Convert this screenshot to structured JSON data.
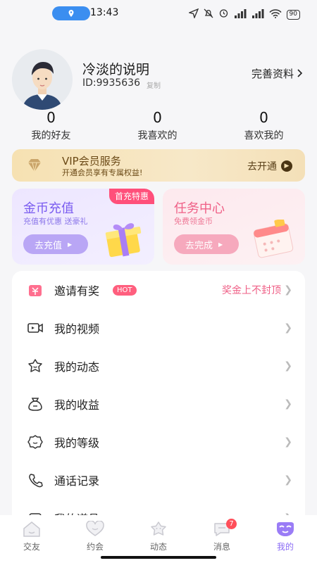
{
  "status_bar": {
    "time": "13:43",
    "battery": "90"
  },
  "profile": {
    "name": "冷淡的说明",
    "id_text": "ID:9935636",
    "copy_label": "复制",
    "edit_label": "完善资料"
  },
  "stats": [
    {
      "value": "0",
      "label": "我的好友"
    },
    {
      "value": "0",
      "label": "我喜欢的"
    },
    {
      "value": "0",
      "label": "喜欢我的"
    }
  ],
  "vip": {
    "title": "VIP会员服务",
    "subtitle": "开通会员享有专属权益!",
    "action": "去开通"
  },
  "coin_card": {
    "title": "金币充值",
    "subtitle": "充值有优惠 送豪礼",
    "button": "去充值",
    "badge": "首充特惠"
  },
  "task_card": {
    "title": "任务中心",
    "subtitle": "免费领金币",
    "button": "去完成"
  },
  "menu": [
    {
      "label": "邀请有奖",
      "tag": "HOT",
      "right": "奖金上不封顶",
      "icon": "gift-box-icon"
    },
    {
      "label": "我的视频",
      "icon": "video-icon"
    },
    {
      "label": "我的动态",
      "icon": "star-face-icon"
    },
    {
      "label": "我的收益",
      "icon": "money-bag-icon"
    },
    {
      "label": "我的等级",
      "icon": "badge-icon"
    },
    {
      "label": "通话记录",
      "icon": "phone-icon"
    },
    {
      "label": "我的道具",
      "icon": "props-icon"
    }
  ],
  "tabs": [
    {
      "label": "交友",
      "icon": "home-icon"
    },
    {
      "label": "约会",
      "icon": "heart-icon"
    },
    {
      "label": "动态",
      "icon": "moment-icon"
    },
    {
      "label": "消息",
      "icon": "message-icon",
      "badge": "7"
    },
    {
      "label": "我的",
      "icon": "mine-icon"
    }
  ],
  "colors": {
    "accent": "#8b6cf5",
    "pink": "#ef5f86",
    "vip_gold": "#6b4a17"
  }
}
